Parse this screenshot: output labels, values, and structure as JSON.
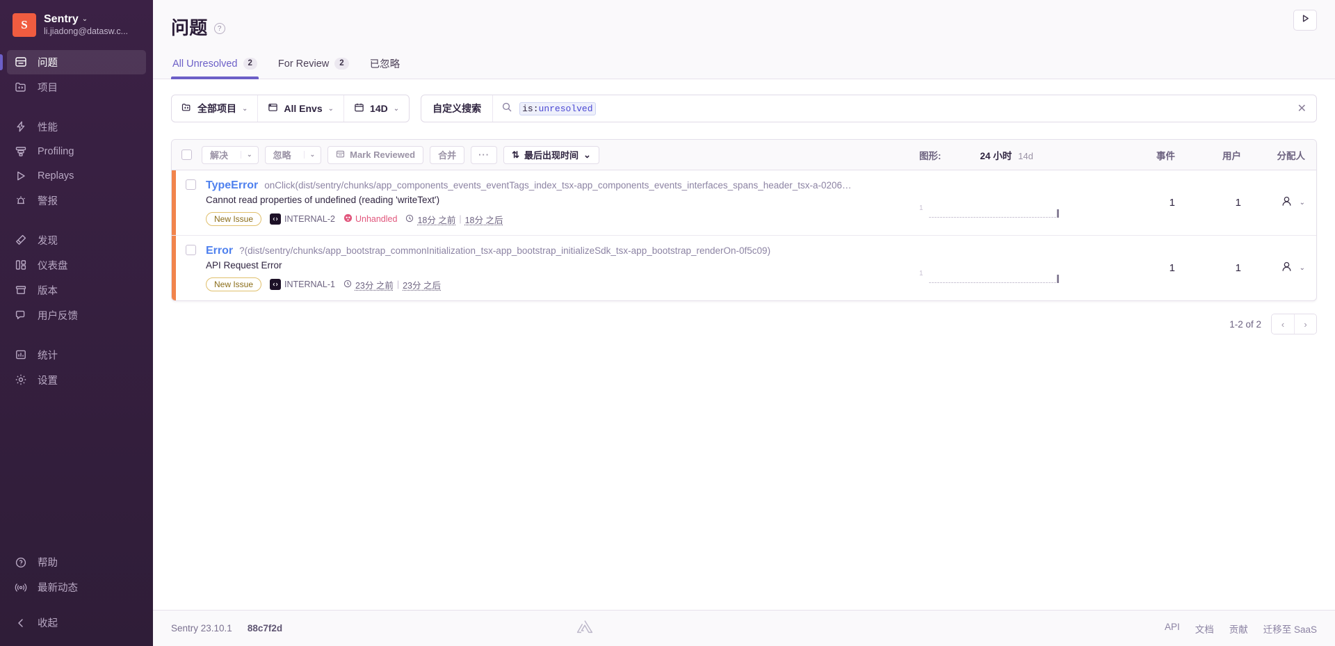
{
  "sidebar": {
    "org": {
      "initial": "S",
      "name": "Sentry",
      "email": "li.jiadong@datasw.c...",
      "chevron": "⌄"
    },
    "groups": [
      {
        "items": [
          {
            "label": "问题",
            "icon": "issues-icon",
            "name": "sidebar-item-issues",
            "active": true
          },
          {
            "label": "项目",
            "icon": "projects-icon",
            "name": "sidebar-item-projects",
            "active": false
          }
        ]
      },
      {
        "items": [
          {
            "label": "性能",
            "icon": "performance-icon",
            "name": "sidebar-item-performance",
            "active": false
          },
          {
            "label": "Profiling",
            "icon": "profiling-icon",
            "name": "sidebar-item-profiling",
            "active": false
          },
          {
            "label": "Replays",
            "icon": "replays-icon",
            "name": "sidebar-item-replays",
            "active": false
          },
          {
            "label": "警报",
            "icon": "alerts-icon",
            "name": "sidebar-item-alerts",
            "active": false
          }
        ]
      },
      {
        "items": [
          {
            "label": "发现",
            "icon": "discover-icon",
            "name": "sidebar-item-discover",
            "active": false
          },
          {
            "label": "仪表盘",
            "icon": "dashboards-icon",
            "name": "sidebar-item-dashboards",
            "active": false
          },
          {
            "label": "版本",
            "icon": "releases-icon",
            "name": "sidebar-item-releases",
            "active": false
          },
          {
            "label": "用户反馈",
            "icon": "user-feedback-icon",
            "name": "sidebar-item-user-feedback",
            "active": false
          }
        ]
      },
      {
        "items": [
          {
            "label": "统计",
            "icon": "stats-icon",
            "name": "sidebar-item-stats",
            "active": false
          },
          {
            "label": "设置",
            "icon": "settings-gear-icon",
            "name": "sidebar-item-settings",
            "active": false
          }
        ]
      }
    ],
    "bottom": [
      {
        "label": "帮助",
        "icon": "help-icon",
        "name": "sidebar-item-help"
      },
      {
        "label": "最新动态",
        "icon": "broadcast-icon",
        "name": "sidebar-item-whats-new"
      }
    ],
    "collapse": {
      "label": "收起",
      "icon": "chevron-left-icon"
    }
  },
  "header": {
    "title": "问题",
    "help_icon": "?",
    "play_button_icon": "play-icon",
    "tabs": [
      {
        "label": "All Unresolved",
        "count": "2",
        "active": true
      },
      {
        "label": "For Review",
        "count": "2",
        "active": false
      },
      {
        "label": "已忽略",
        "count": "",
        "active": false
      }
    ]
  },
  "filters": {
    "project": {
      "label": "全部项目",
      "chevron": "⌄"
    },
    "environment": {
      "label": "All Envs",
      "chevron": "⌄"
    },
    "datetime": {
      "label": "14D",
      "chevron": "⌄"
    },
    "saved_search": "自定义搜索",
    "query_key": "is:",
    "query_value": "unresolved",
    "query_full": "is:unresolved",
    "clear_icon": "✕"
  },
  "toolbar": {
    "resolve": "解决",
    "ignore": "忽略",
    "mark_reviewed": "Mark Reviewed",
    "merge": "合并",
    "more": "···",
    "sort": "最后出现时间",
    "sort_icon": "⇅",
    "caret": "⌄"
  },
  "columns": {
    "graph_label": "图形:",
    "graph_opt_24h": "24 小时",
    "graph_opt_14d": "14d",
    "events": "事件",
    "users": "用户",
    "assignee": "分配人"
  },
  "issues": [
    {
      "level_color": "#f1844c",
      "type": "TypeError",
      "culprit": "onClick(dist/sentry/chunks/app_components_events_eventTags_index_tsx-app_components_events_interfaces_spans_header_tsx-a-0206…",
      "message": "Cannot read properties of undefined (reading 'writeText')",
      "badge": "New Issue",
      "project": "INTERNAL-2",
      "unhandled": "Unhandled",
      "first_seen": "18分 之前",
      "last_seen": "18分 之后",
      "sparkline_axis": "1",
      "sparkline": [
        0,
        0,
        0,
        0,
        0,
        0,
        0,
        0,
        0,
        0,
        0,
        0,
        0,
        0,
        0,
        0,
        0,
        0,
        0,
        0,
        0,
        0,
        0,
        0,
        0,
        0,
        0,
        0,
        0,
        0,
        0,
        0,
        0,
        0,
        0,
        0,
        0,
        0,
        0,
        0,
        0,
        0,
        0,
        0,
        0,
        0,
        8
      ],
      "events": "1",
      "users": "1",
      "assignee_icon": "user-avatar-icon"
    },
    {
      "level_color": "#f1844c",
      "type": "Error",
      "culprit": "?(dist/sentry/chunks/app_bootstrap_commonInitialization_tsx-app_bootstrap_initializeSdk_tsx-app_bootstrap_renderOn-0f5c09)",
      "message": "API Request Error",
      "badge": "New Issue",
      "project": "INTERNAL-1",
      "unhandled": "",
      "first_seen": "23分 之前",
      "last_seen": "23分 之后",
      "sparkline_axis": "1",
      "sparkline": [
        0,
        0,
        0,
        0,
        0,
        0,
        0,
        0,
        0,
        0,
        0,
        0,
        0,
        0,
        0,
        0,
        0,
        0,
        0,
        0,
        0,
        0,
        0,
        0,
        0,
        0,
        0,
        0,
        0,
        0,
        0,
        0,
        0,
        0,
        0,
        0,
        0,
        0,
        0,
        0,
        0,
        0,
        0,
        0,
        0,
        0,
        8
      ],
      "events": "1",
      "users": "1",
      "assignee_icon": "user-avatar-icon"
    }
  ],
  "pagination": {
    "label": "1-2 of 2",
    "prev_icon": "‹",
    "next_icon": "›"
  },
  "footer": {
    "version": "Sentry 23.10.1",
    "hash": "88c7f2d",
    "links": [
      "API",
      "文档",
      "贡献",
      "迁移至 SaaS"
    ]
  },
  "colors": {
    "accent": "#6c5fc7",
    "brand_orange": "#f05c40",
    "level_warning": "#f1844c",
    "link_blue": "#4e80ee",
    "unhandled_pink": "#e1567c",
    "sidebar_bg": "#3b2145"
  }
}
